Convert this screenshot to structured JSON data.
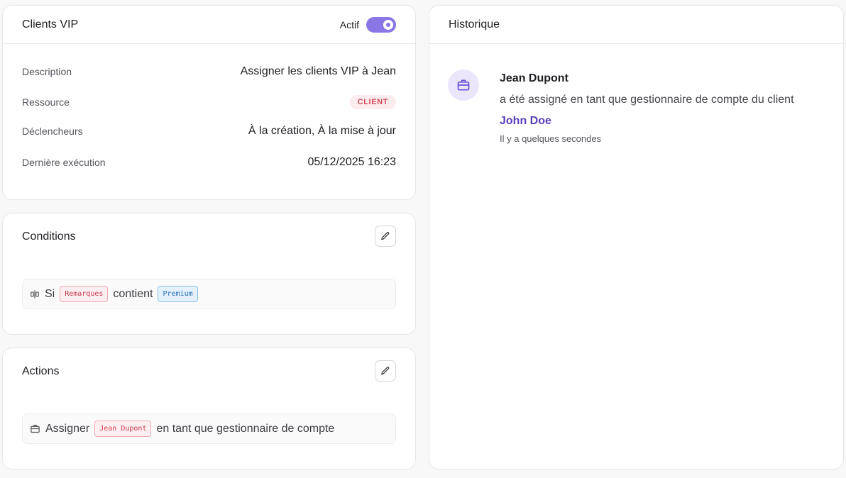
{
  "colors": {
    "accent": "#8b76e6",
    "accent_text": "#5a3fc0",
    "badge_bg": "#fdecee",
    "badge_text": "#d24a5a"
  },
  "rule": {
    "title": "Clients VIP",
    "status_label": "Actif",
    "enabled": true,
    "description_label": "Description",
    "description_value": "Assigner les clients VIP à Jean",
    "resource_label": "Ressource",
    "resource_value": "CLIENT",
    "triggers_label": "Déclencheurs",
    "triggers_value": "À la création, À la mise à jour",
    "last_run_label": "Dernière exécution",
    "last_run_value": "05/12/2025 16:23"
  },
  "conditions": {
    "title": "Conditions",
    "edit_icon": "pencil-icon",
    "line": {
      "icon": "split-icon",
      "prefix": "Si",
      "field_tag": "Remarques",
      "operator": "contient",
      "value_tag": "Premium"
    }
  },
  "actions": {
    "title": "Actions",
    "edit_icon": "pencil-icon",
    "line": {
      "icon": "briefcase-icon",
      "verb": "Assigner",
      "user_tag": "Jean Dupont",
      "suffix": "en tant que gestionnaire de compte"
    }
  },
  "history": {
    "title": "Historique",
    "items": [
      {
        "icon": "briefcase-icon",
        "name": "Jean Dupont",
        "text": "a été assigné en tant que gestionnaire de compte du client",
        "author": "John Doe",
        "time": "Il y a quelques secondes"
      }
    ]
  }
}
